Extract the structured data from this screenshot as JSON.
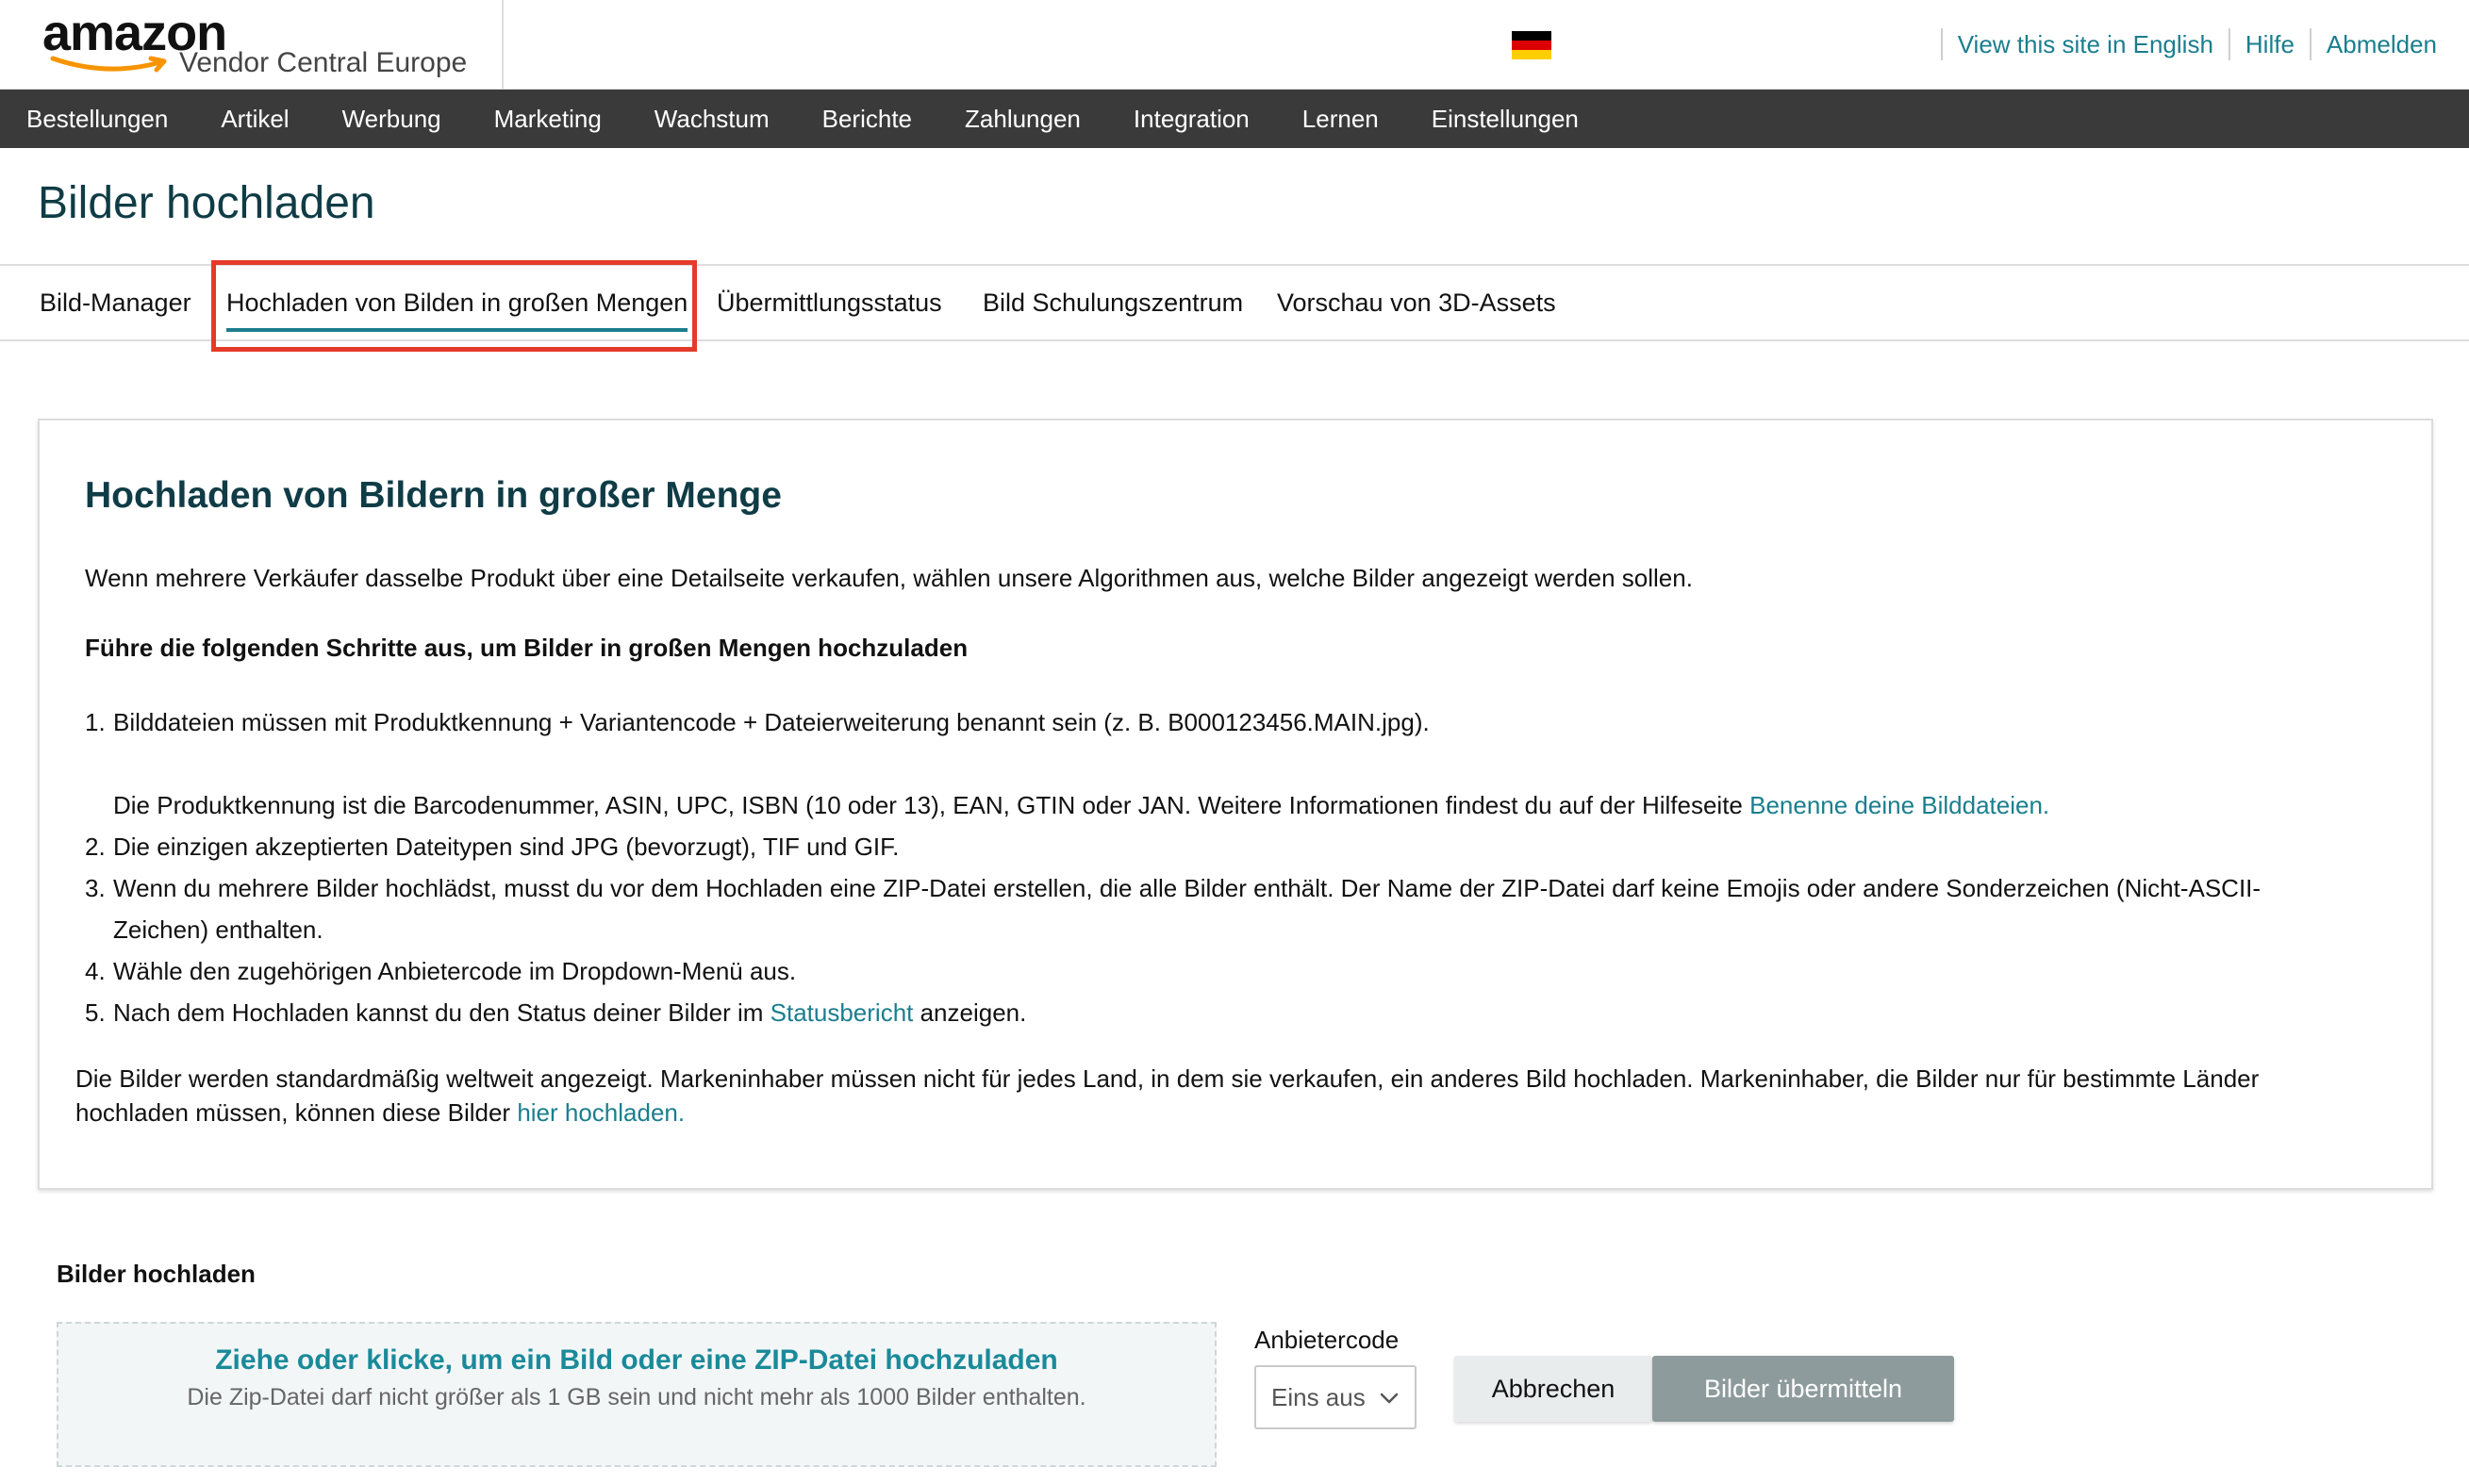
{
  "header": {
    "logo_word": "amazon",
    "logo_sub": "Vendor Central Europe",
    "links": [
      "View this site in English",
      "Hilfe",
      "Abmelden"
    ],
    "flag_colors": [
      "#000000",
      "#dd0000",
      "#ffce00"
    ]
  },
  "nav": {
    "items": [
      "Bestellungen",
      "Artikel",
      "Werbung",
      "Marketing",
      "Wachstum",
      "Berichte",
      "Zahlungen",
      "Integration",
      "Lernen",
      "Einstellungen"
    ]
  },
  "page": {
    "title": "Bilder hochladen"
  },
  "tabs": [
    {
      "label": "Bild-Manager"
    },
    {
      "label": "Hochladen von Bilden in großen Mengen"
    },
    {
      "label": "Übermittlungsstatus"
    },
    {
      "label": "Bild Schulungszentrum"
    },
    {
      "label": "Vorschau von 3D-Assets"
    }
  ],
  "card": {
    "heading": "Hochladen von Bildern in großer Menge",
    "intro": "Wenn mehrere Verkäufer dasselbe Produkt über eine Detailseite verkaufen, wählen unsere Algorithmen aus, welche Bilder angezeigt werden sollen.",
    "steps_title": "Führe die folgenden Schritte aus, um Bilder in großen Mengen hochzuladen",
    "step1": "Bilddateien müssen mit Produktkennung + Variantencode + Dateierweiterung benannt sein (z. B. B000123456.MAIN.jpg).",
    "step1_detail": "Die Produktkennung ist die Barcodenummer, ASIN, UPC, ISBN (10 oder 13), EAN, GTIN oder JAN. Weitere Informationen findest du auf der Hilfeseite ",
    "step1_link": "Benenne deine Bilddateien.",
    "step2": "Die einzigen akzeptierten Dateitypen sind JPG (bevorzugt), TIF und GIF.",
    "step3_line1": "Wenn du mehrere Bilder hochlädst, musst du vor dem Hochladen eine ZIP-Datei erstellen, die alle Bilder enthält. Der Name der ZIP-Datei darf keine Emojis oder andere Sonderzeichen (Nicht-ASCII-",
    "step3_line2": "Zeichen) enthalten.",
    "step4": "Wähle den zugehörigen Anbietercode im Dropdown-Menü aus.",
    "step5_pre": "Nach dem Hochladen kannst du den Status deiner Bilder im ",
    "step5_link": "Statusbericht",
    "step5_post": " anzeigen.",
    "footer_text": "Die Bilder werden standardmäßig weltweit angezeigt. Markeninhaber müssen nicht für jedes Land, in dem sie verkaufen, ein anderes Bild hochladen. Markeninhaber, die Bilder nur für bestimmte Länder hochladen müssen, können diese Bilder ",
    "footer_link": "hier hochladen."
  },
  "upload": {
    "title": "Bilder hochladen",
    "dropzone_main": "Ziehe oder klicke, um ein Bild oder eine ZIP-Datei hochzuladen",
    "dropzone_sub": "Die Zip-Datei darf nicht größer als 1 GB sein und nicht mehr als 1000 Bilder enthalten.",
    "anbieter_label": "Anbietercode",
    "select_value": "Eins aus",
    "cancel_label": "Abbrechen",
    "submit_label": "Bilder übermitteln"
  }
}
